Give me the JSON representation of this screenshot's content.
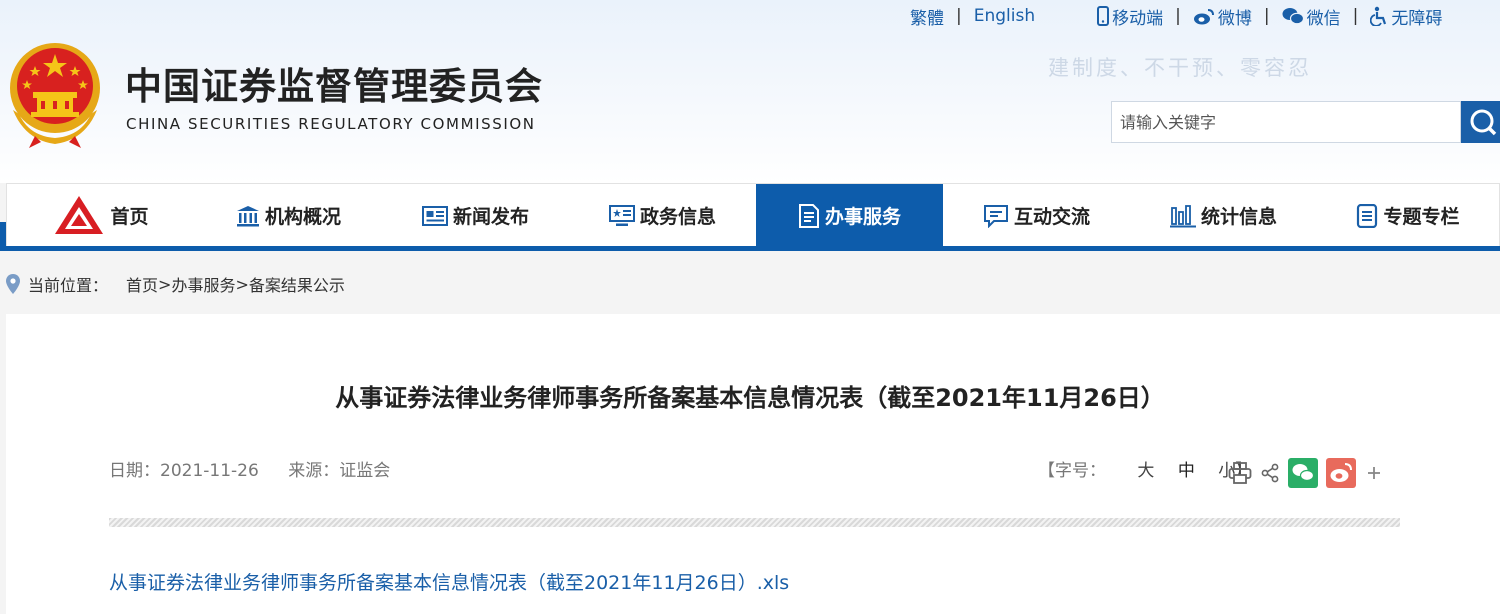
{
  "header": {
    "title_cn": "中国证券监督管理委员会",
    "title_en": "CHINA SECURITIES REGULATORY COMMISSION",
    "slogan": "建制度、不干预、零容忍"
  },
  "toplinks": {
    "traditional": "繁體",
    "english": "English",
    "mobile": "移动端",
    "weibo": "微博",
    "wechat": "微信",
    "accessible": "无障碍",
    "separator": "|"
  },
  "search": {
    "placeholder": "请输入关键字"
  },
  "nav": {
    "items": [
      {
        "label": "首页",
        "icon": "csrc-logo-icon"
      },
      {
        "label": "机构概况",
        "icon": "building-icon"
      },
      {
        "label": "新闻发布",
        "icon": "news-icon"
      },
      {
        "label": "政务信息",
        "icon": "monitor-icon"
      },
      {
        "label": "办事服务",
        "icon": "document-icon",
        "active": true
      },
      {
        "label": "互动交流",
        "icon": "chat-icon"
      },
      {
        "label": "统计信息",
        "icon": "bar-chart-icon"
      },
      {
        "label": "专题专栏",
        "icon": "list-icon"
      }
    ]
  },
  "breadcrumb": {
    "label": "当前位置：",
    "home": "首页",
    "section": "办事服务",
    "page": "备案结果公示",
    "separator": ">"
  },
  "article": {
    "title": "从事证券法律业务律师事务所备案基本信息情况表（截至2021年11月26日）",
    "date_label": "日期：",
    "date": "2021-11-26",
    "source_label": "来源：",
    "source": "证监会",
    "fontsize_label": "【字号：",
    "fontsize_large": "大",
    "fontsize_medium": "中",
    "fontsize_small": "小】",
    "attachment": "从事证券法律业务律师事务所备案基本信息情况表（截至2021年11月26日）.xls"
  },
  "colors": {
    "brand_blue": "#0d5cab",
    "link_blue": "#1a5fa8",
    "wechat_green": "#2aae67",
    "weibo_red": "#e86a5c"
  }
}
